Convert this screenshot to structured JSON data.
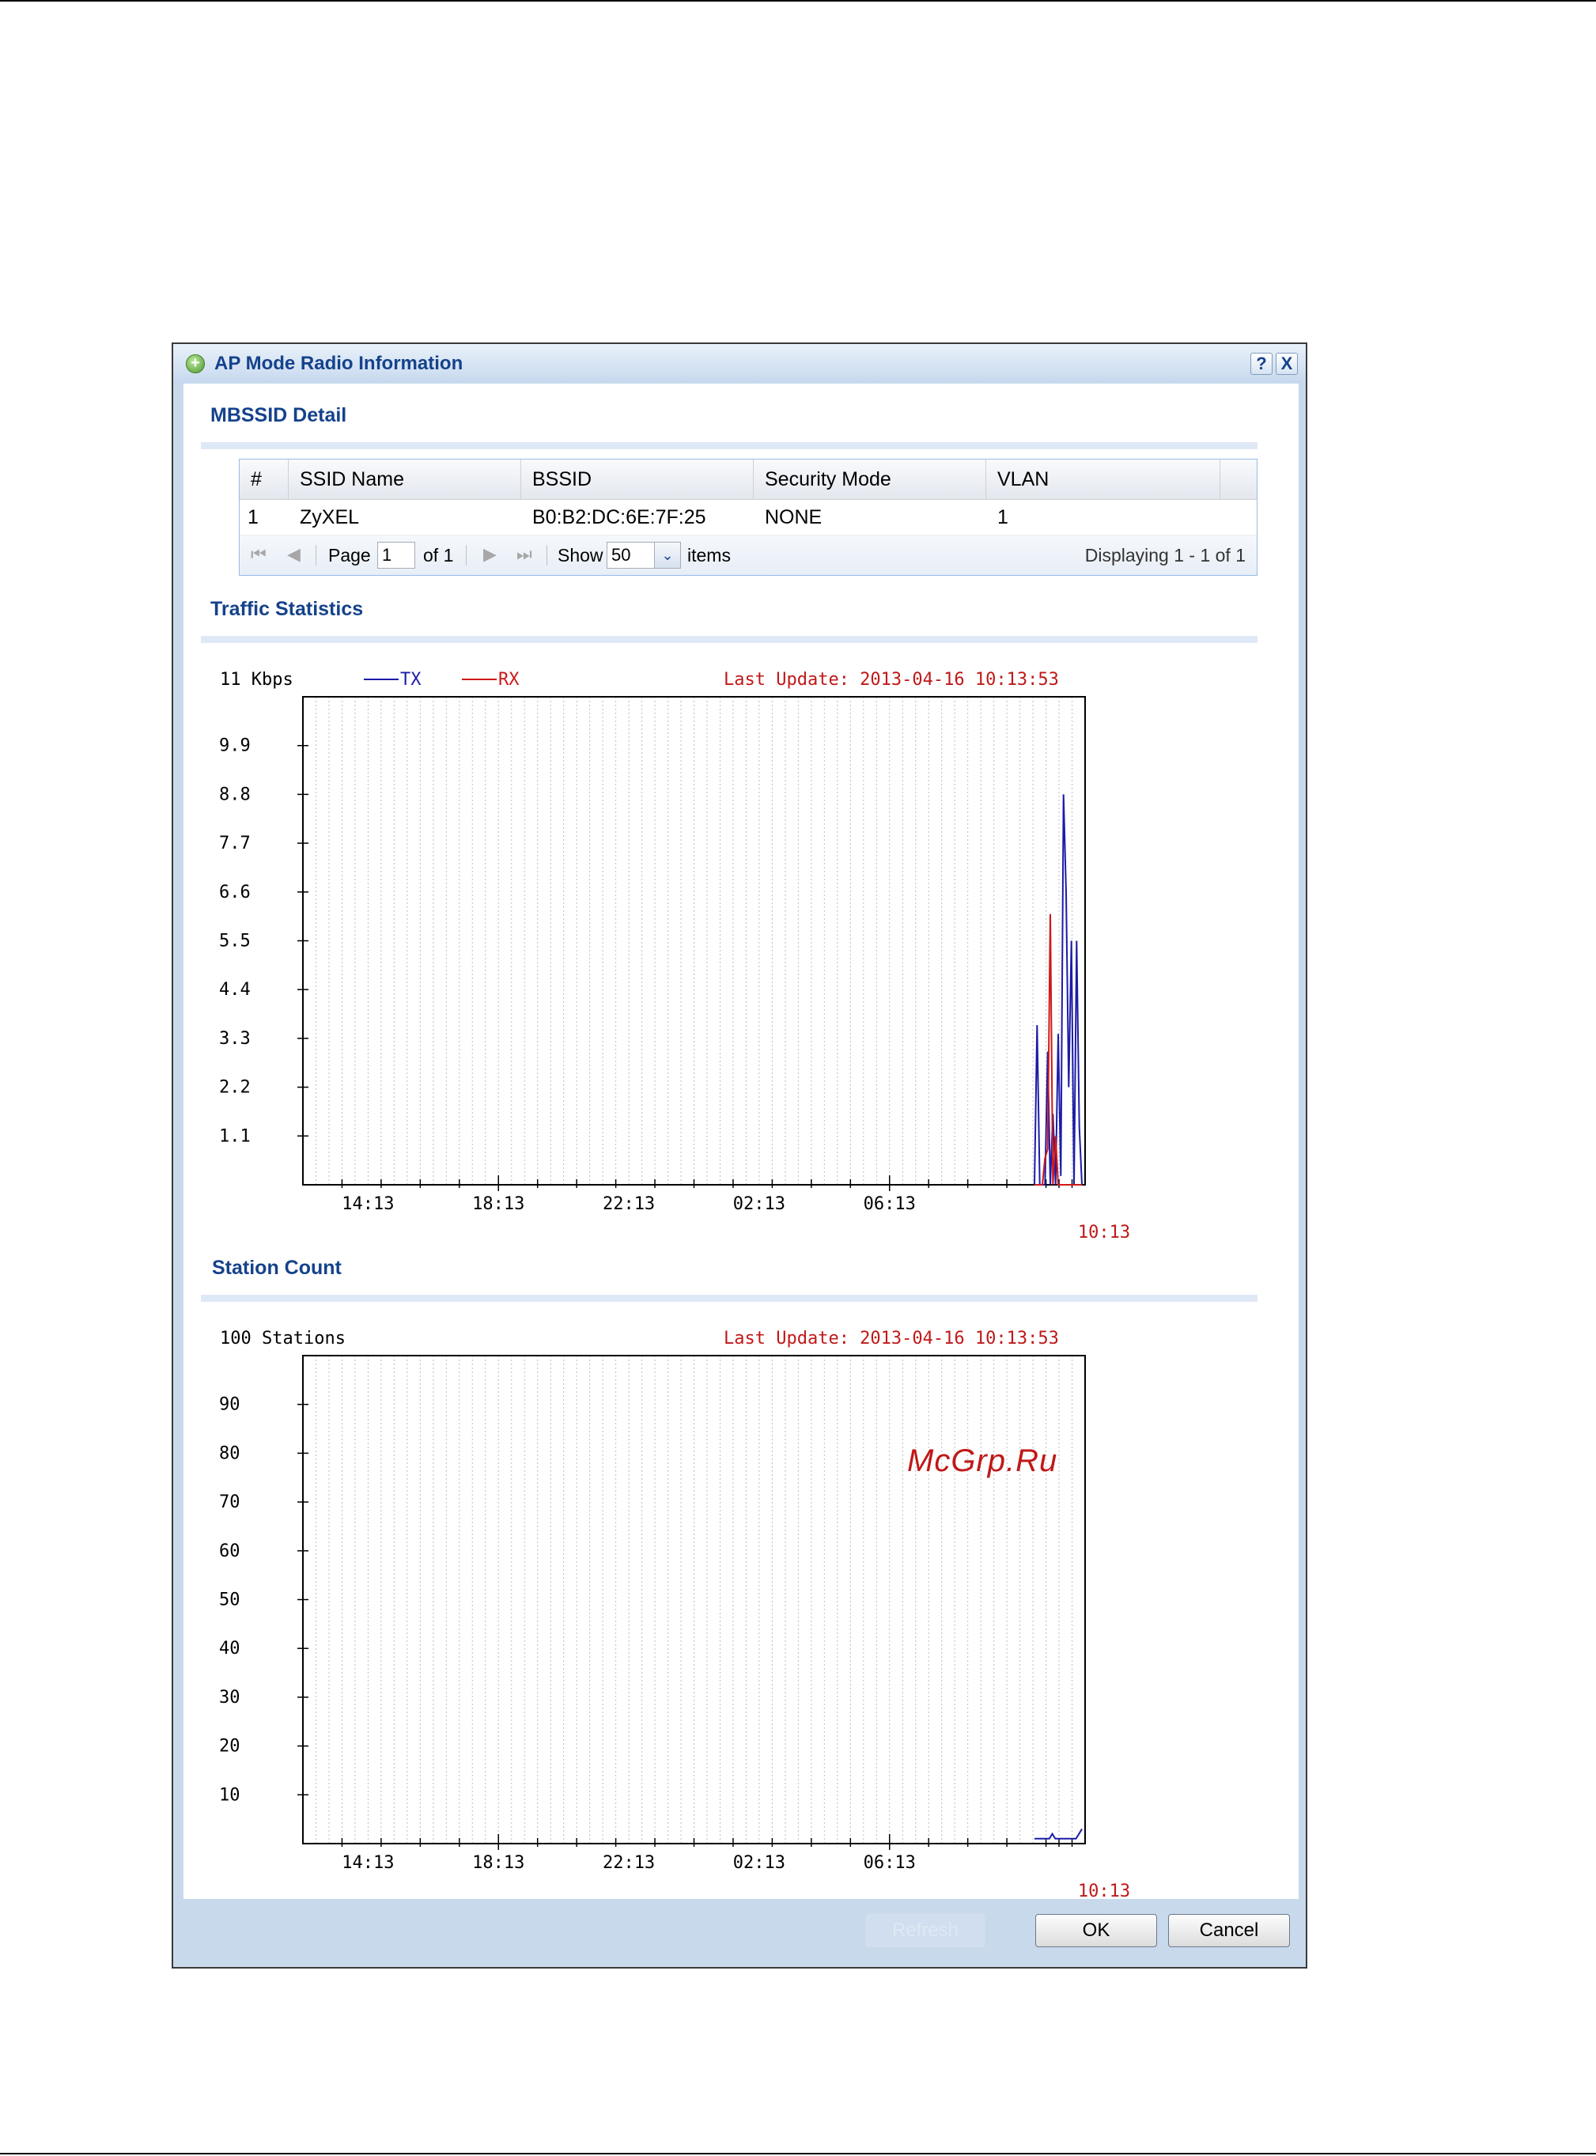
{
  "dialog": {
    "title": "AP Mode Radio Information",
    "help_label": "?",
    "close_label": "X",
    "ok_label": "OK",
    "cancel_label": "Cancel",
    "refresh_label": "Refresh"
  },
  "mbssid": {
    "section_title": "MBSSID Detail",
    "columns": [
      "#",
      "SSID Name",
      "BSSID",
      "Security Mode",
      "VLAN"
    ],
    "rows": [
      {
        "num": "1",
        "ssid": "ZyXEL",
        "bssid": "B0:B2:DC:6E:7F:25",
        "security": "NONE",
        "vlan": "1"
      }
    ],
    "pager": {
      "page_label": "Page",
      "page_value": "1",
      "of_label": "of 1",
      "show_label": "Show",
      "show_value": "50",
      "items_label": "items",
      "displaying": "Displaying 1 - 1 of 1"
    }
  },
  "traffic": {
    "section_title": "Traffic Statistics",
    "unit_label": "11 Kbps",
    "legend_tx": "TX",
    "legend_rx": "RX",
    "last_update": "Last Update: 2013-04-16 10:13:53"
  },
  "stations": {
    "section_title": "Station Count",
    "unit_label": "100 Stations",
    "last_update": "Last Update: 2013-04-16 10:13:53"
  },
  "watermark": "McGrp.Ru",
  "colors": {
    "tx": "#1c1ca8",
    "rx": "#d01818",
    "title": "#15428b",
    "last_update": "#c01818"
  },
  "chart_data": [
    {
      "type": "line",
      "title": "Traffic Statistics",
      "ylabel": "11 Kbps",
      "ylim": [
        0,
        11
      ],
      "yticks": [
        "1.1",
        "2.2",
        "3.3",
        "4.4",
        "5.5",
        "6.6",
        "7.7",
        "8.8",
        "9.9"
      ],
      "xticks": [
        "14:13",
        "18:13",
        "22:13",
        "02:13",
        "06:13"
      ],
      "x_end_label": "10:13",
      "grid": true,
      "series": [
        {
          "name": "TX",
          "color": "#1c1ca8",
          "values": [
            0,
            3.6,
            0,
            0,
            0,
            3.0,
            0,
            1.6,
            0,
            3.4,
            0.2,
            8.8,
            6.6,
            2.2,
            5.5,
            0,
            5.5,
            1.3,
            0
          ]
        },
        {
          "name": "RX",
          "color": "#d01818",
          "values": [
            0,
            0,
            0,
            0,
            0.6,
            0.8,
            6.1,
            0,
            1.1,
            0,
            0,
            0,
            0,
            0,
            0,
            0,
            0,
            0,
            0
          ]
        }
      ]
    },
    {
      "type": "line",
      "title": "Station Count",
      "ylabel": "100 Stations",
      "ylim": [
        0,
        100
      ],
      "yticks": [
        "10",
        "20",
        "30",
        "40",
        "50",
        "60",
        "70",
        "80",
        "90"
      ],
      "xticks": [
        "14:13",
        "18:13",
        "22:13",
        "02:13",
        "06:13"
      ],
      "x_end_label": "10:13",
      "grid": true,
      "series": [
        {
          "color": "#1c1ca8",
          "values": [
            1,
            1,
            1,
            1,
            1,
            1,
            2,
            1,
            1,
            1,
            1,
            1,
            1,
            1,
            1,
            2,
            3
          ]
        }
      ]
    }
  ]
}
